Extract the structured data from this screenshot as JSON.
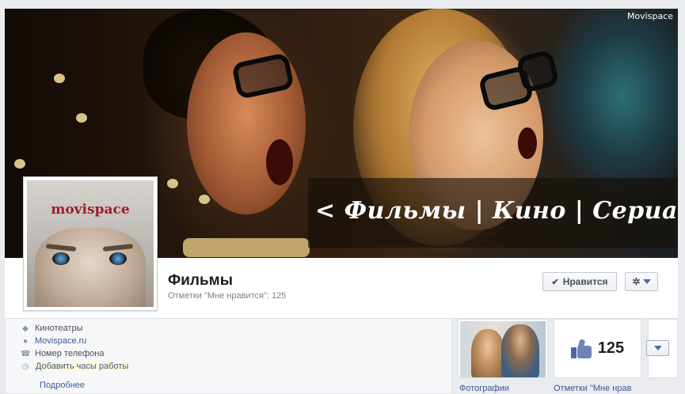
{
  "cover": {
    "slogan": "< Фильмы | Кино | Сериалы",
    "watermark": "Movispace"
  },
  "profile": {
    "logo_text": "movispace"
  },
  "header": {
    "page_title": "Фильмы",
    "likes_line": "Отметки \"Мне нравится\": 125",
    "like_button_label": "Нравится",
    "like_button_icon": "check-icon",
    "settings_icon": "gear-icon"
  },
  "about": {
    "category": "Кинотеатры",
    "category_icon": "tag-icon",
    "website": "Movispace.ru",
    "website_icon": "map-pin-icon",
    "phone": "Номер телефона",
    "phone_icon": "phone-icon",
    "hours": "Добавить часы работы",
    "hours_icon": "clock-icon",
    "more": "Подробнее"
  },
  "apps": {
    "photos_label": "Фотографии",
    "likes_label": "Отметки \"Мне нрав",
    "likes_value": "125",
    "likes_icon": "thumbs-up-icon"
  },
  "colors": {
    "link": "#3b5998",
    "page_background": "#e9ebee",
    "highlight": "#fff9d7"
  }
}
